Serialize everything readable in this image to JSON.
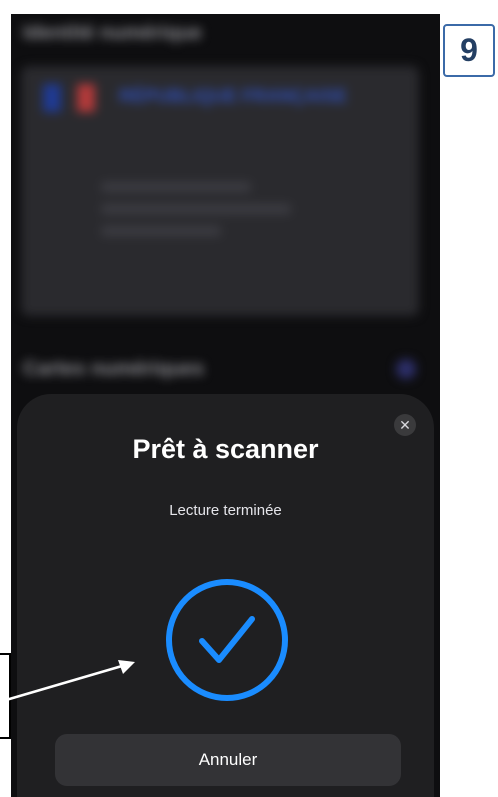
{
  "background": {
    "section1_title": "Identité numérique",
    "card_title": "RÉPUBLIQUE FRANÇAISE",
    "section2_title": "Cartes numériques"
  },
  "sheet": {
    "title": "Prêt à scanner",
    "status": "Lecture terminée",
    "close_icon": "close-icon",
    "check_icon": "checkmark-circle-icon",
    "cancel_label": "Annuler"
  },
  "annotation": {
    "step_number": "9"
  },
  "colors": {
    "accent": "#1a8cff",
    "sheet_bg": "#1f1f21",
    "button_bg": "#333336"
  }
}
